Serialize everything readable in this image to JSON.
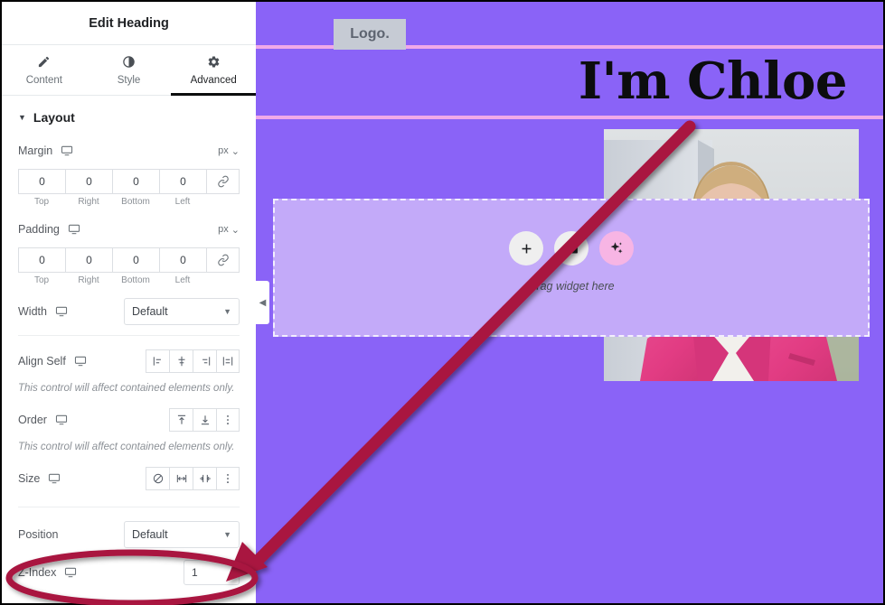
{
  "panel": {
    "title": "Edit Heading",
    "tabs": [
      {
        "label": "Content",
        "icon": "pencil-icon",
        "active": false
      },
      {
        "label": "Style",
        "icon": "contrast-icon",
        "active": false
      },
      {
        "label": "Advanced",
        "icon": "gear-icon",
        "active": true
      }
    ],
    "section": {
      "label": "Layout",
      "expanded": true
    },
    "margin": {
      "label": "Margin",
      "unit": "px",
      "values": [
        "0",
        "0",
        "0",
        "0"
      ],
      "sides": [
        "Top",
        "Right",
        "Bottom",
        "Left"
      ],
      "link": "link-icon"
    },
    "padding": {
      "label": "Padding",
      "unit": "px",
      "values": [
        "0",
        "0",
        "0",
        "0"
      ],
      "sides": [
        "Top",
        "Right",
        "Bottom",
        "Left"
      ],
      "link": "link-icon"
    },
    "width": {
      "label": "Width",
      "value": "Default"
    },
    "align_self": {
      "label": "Align Self",
      "options": [
        "align-start-icon",
        "align-center-icon",
        "align-end-icon",
        "align-stretch-icon"
      ],
      "hint": "This control will affect contained elements only."
    },
    "order": {
      "label": "Order",
      "options": [
        "order-start-icon",
        "order-end-icon",
        "more-options-icon"
      ],
      "hint": "This control will affect contained elements only."
    },
    "size": {
      "label": "Size",
      "options": [
        "none-icon",
        "grow-icon",
        "shrink-icon",
        "more-options-icon"
      ]
    },
    "position": {
      "label": "Position",
      "value": "Default"
    },
    "z_index": {
      "label": "Z-Index",
      "value": "1"
    },
    "collapse_handle": "chevron-left-icon",
    "device_icon": "desktop-icon"
  },
  "canvas": {
    "logo": "Logo.",
    "heading": "I'm Chloe",
    "dropzone": {
      "drag_text": "Drag widget here",
      "buttons": [
        "add-widget-icon",
        "folder-icon",
        "ai-sparkle-icon"
      ]
    },
    "photo_alt": "model-photo"
  },
  "colors": {
    "canvas_purple": "#8a63f7",
    "divider_pink": "#f0a9e8",
    "dropzone_fill": "#c3aaf9",
    "annotation_crimson": "#a9123f",
    "ai_button_pink": "#f7b5e4",
    "active_tab_underline": "#0c0d0e"
  },
  "annotations": {
    "arrow": "arrow-pointing-to-z-index",
    "ellipse": "ellipse-highlighting-z-index-row"
  }
}
